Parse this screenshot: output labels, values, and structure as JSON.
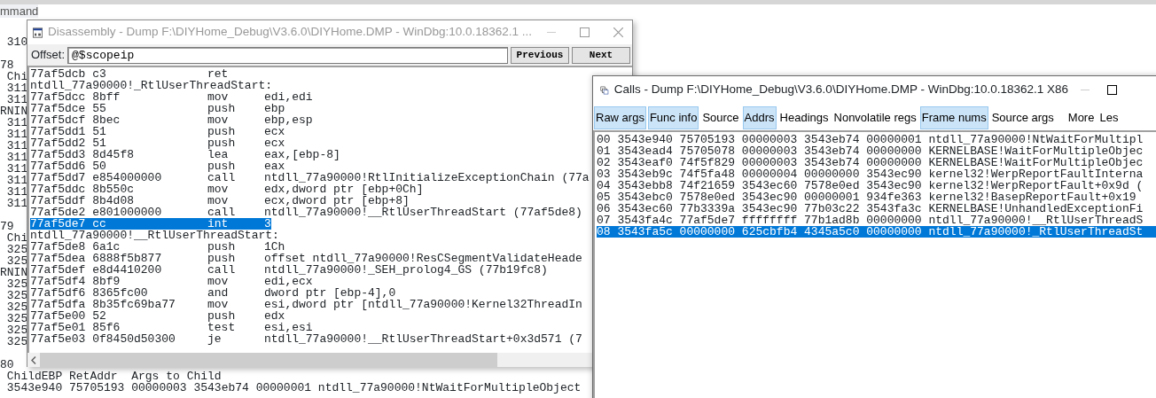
{
  "command_window": {
    "title": "mmand",
    "lines": [
      {
        "kind": "detail",
        "text": "310"
      },
      {
        "kind": "blank"
      },
      {
        "kind": "head",
        "text": "78"
      },
      {
        "kind": "detail",
        "text": "Chi"
      },
      {
        "kind": "detail",
        "text": "311"
      },
      {
        "kind": "detail",
        "text": "311"
      },
      {
        "kind": "head",
        "text": "RNIN"
      },
      {
        "kind": "detail",
        "text": "311"
      },
      {
        "kind": "detail",
        "text": "311"
      },
      {
        "kind": "detail",
        "text": "311"
      },
      {
        "kind": "detail",
        "text": "311"
      },
      {
        "kind": "detail",
        "text": "311"
      },
      {
        "kind": "detail",
        "text": "311"
      },
      {
        "kind": "detail",
        "text": "311"
      },
      {
        "kind": "detail",
        "text": "311"
      },
      {
        "kind": "blank"
      },
      {
        "kind": "head",
        "text": "79"
      },
      {
        "kind": "detail",
        "text": "Chi"
      },
      {
        "kind": "detail",
        "text": "325"
      },
      {
        "kind": "detail",
        "text": "325"
      },
      {
        "kind": "head",
        "text": "RNIN"
      },
      {
        "kind": "detail",
        "text": "325"
      },
      {
        "kind": "detail",
        "text": "325"
      },
      {
        "kind": "detail",
        "text": "325"
      },
      {
        "kind": "detail",
        "text": "325"
      },
      {
        "kind": "detail",
        "text": "325"
      },
      {
        "kind": "detail",
        "text": "325"
      },
      {
        "kind": "blank"
      },
      {
        "kind": "head",
        "text": "80"
      },
      {
        "kind": "detail",
        "text": "ChildEBP RetAddr  Args to Child"
      },
      {
        "kind": "detail",
        "text": "3543e940 75705193 00000003 3543eb74 00000001 ntdll_77a90000!NtWaitForMultipleObject"
      }
    ]
  },
  "disassembly_window": {
    "title": "Disassembly - Dump F:\\DIYHome_Debug\\V3.6.0\\DIYHome.DMP - WinDbg:10.0.18362.1 ...",
    "offset_label": "Offset:",
    "offset_value": "@$scopeip",
    "buttons": [
      "Previous",
      "Next"
    ],
    "lines": [
      {
        "kind": "instruction",
        "address": "77af5dcb",
        "bytes": "c3",
        "mnemonic": "ret",
        "selected": false
      },
      {
        "kind": "label",
        "text": "ntdll_77a90000!_RtlUserThreadStart:",
        "selected": false
      },
      {
        "kind": "instruction",
        "address": "77af5dcc",
        "bytes": "8bff",
        "mnemonic": "mov",
        "operands": "edi,edi",
        "selected": false
      },
      {
        "kind": "instruction",
        "address": "77af5dce",
        "bytes": "55",
        "mnemonic": "push",
        "operands": "ebp",
        "selected": false
      },
      {
        "kind": "instruction",
        "address": "77af5dcf",
        "bytes": "8bec",
        "mnemonic": "mov",
        "operands": "ebp,esp",
        "selected": false
      },
      {
        "kind": "instruction",
        "address": "77af5dd1",
        "bytes": "51",
        "mnemonic": "push",
        "operands": "ecx",
        "selected": false
      },
      {
        "kind": "instruction",
        "address": "77af5dd2",
        "bytes": "51",
        "mnemonic": "push",
        "operands": "ecx",
        "selected": false
      },
      {
        "kind": "instruction",
        "address": "77af5dd3",
        "bytes": "8d45f8",
        "mnemonic": "lea",
        "operands": "eax,[ebp-8]",
        "selected": false
      },
      {
        "kind": "instruction",
        "address": "77af5dd6",
        "bytes": "50",
        "mnemonic": "push",
        "operands": "eax",
        "selected": false
      },
      {
        "kind": "instruction",
        "address": "77af5dd7",
        "bytes": "e854000000",
        "mnemonic": "call",
        "operands": "ntdll_77a90000!RtlInitializeExceptionChain (77a",
        "selected": false
      },
      {
        "kind": "instruction",
        "address": "77af5ddc",
        "bytes": "8b550c",
        "mnemonic": "mov",
        "operands": "edx,dword ptr [ebp+0Ch]",
        "selected": false
      },
      {
        "kind": "instruction",
        "address": "77af5ddf",
        "bytes": "8b4d08",
        "mnemonic": "mov",
        "operands": "ecx,dword ptr [ebp+8]",
        "selected": false
      },
      {
        "kind": "instruction",
        "address": "77af5de2",
        "bytes": "e801000000",
        "mnemonic": "call",
        "operands": "ntdll_77a90000!__RtlUserThreadStart (77af5de8)",
        "selected": false
      },
      {
        "kind": "instruction",
        "address": "77af5de7",
        "bytes": "cc",
        "mnemonic": "int",
        "operands": "3",
        "selected": true
      },
      {
        "kind": "label",
        "text": "ntdll_77a90000!__RtlUserThreadStart:",
        "selected": false
      },
      {
        "kind": "instruction",
        "address": "77af5de8",
        "bytes": "6a1c",
        "mnemonic": "push",
        "operands": "1Ch",
        "selected": false
      },
      {
        "kind": "instruction",
        "address": "77af5dea",
        "bytes": "6888f5b877",
        "mnemonic": "push",
        "operands": "offset ntdll_77a90000!ResCSegmentValidateHeade",
        "selected": false
      },
      {
        "kind": "instruction",
        "address": "77af5def",
        "bytes": "e8d4410200",
        "mnemonic": "call",
        "operands": "ntdll_77a90000!_SEH_prolog4_GS (77b19fc8)",
        "selected": false
      },
      {
        "kind": "instruction",
        "address": "77af5df4",
        "bytes": "8bf9",
        "mnemonic": "mov",
        "operands": "edi,ecx",
        "selected": false
      },
      {
        "kind": "instruction",
        "address": "77af5df6",
        "bytes": "8365fc00",
        "mnemonic": "and",
        "operands": "dword ptr [ebp-4],0",
        "selected": false
      },
      {
        "kind": "instruction",
        "address": "77af5dfa",
        "bytes": "8b35fc69ba77",
        "mnemonic": "mov",
        "operands": "esi,dword ptr [ntdll_77a90000!Kernel32ThreadIn",
        "selected": false
      },
      {
        "kind": "instruction",
        "address": "77af5e00",
        "bytes": "52",
        "mnemonic": "push",
        "operands": "edx",
        "selected": false
      },
      {
        "kind": "instruction",
        "address": "77af5e01",
        "bytes": "85f6",
        "mnemonic": "test",
        "operands": "esi,esi",
        "selected": false
      },
      {
        "kind": "instruction",
        "address": "77af5e03",
        "bytes": "0f8450d50300",
        "mnemonic": "je",
        "operands": "ntdll_77a90000!__RtlUserThreadStart+0x3d571 (7",
        "selected": false
      }
    ]
  },
  "calls_window": {
    "title": "Calls - Dump F:\\DIYHome_Debug\\V3.6.0\\DIYHome.DMP - WinDbg:10.0.18362.1 X86",
    "toolbar": [
      {
        "label": "Raw args",
        "selected": true
      },
      {
        "label": "Func info",
        "selected": true
      },
      {
        "label": "Source",
        "selected": false
      },
      {
        "label": "Addrs",
        "selected": true
      },
      {
        "label": "Headings",
        "selected": false
      },
      {
        "label": "Nonvolatile regs",
        "selected": false
      },
      {
        "label": "Frame nums",
        "selected": true
      },
      {
        "label": "Source args",
        "selected": false
      },
      {
        "label": "More",
        "selected": false
      },
      {
        "label": "Les",
        "selected": false
      }
    ],
    "frames": [
      {
        "num": "00",
        "child_ebp": "3543e940",
        "ret_addr": "75705193",
        "args": [
          "00000003",
          "3543eb74",
          "00000001"
        ],
        "call_site": "ntdll_77a90000!NtWaitForMultipl",
        "selected": false
      },
      {
        "num": "01",
        "child_ebp": "3543ead4",
        "ret_addr": "75705078",
        "args": [
          "00000003",
          "3543eb74",
          "00000000"
        ],
        "call_site": "KERNELBASE!WaitForMultipleObjec",
        "selected": false
      },
      {
        "num": "02",
        "child_ebp": "3543eaf0",
        "ret_addr": "74f5f829",
        "args": [
          "00000003",
          "3543eb74",
          "00000000"
        ],
        "call_site": "KERNELBASE!WaitForMultipleObjec",
        "selected": false
      },
      {
        "num": "03",
        "child_ebp": "3543eb9c",
        "ret_addr": "74f5fa48",
        "args": [
          "00000004",
          "00000000",
          "3543ec90"
        ],
        "call_site": "kernel32!WerpReportFaultInterna",
        "selected": false
      },
      {
        "num": "04",
        "child_ebp": "3543ebb8",
        "ret_addr": "74f21659",
        "args": [
          "3543ec60",
          "7578e0ed",
          "3543ec90"
        ],
        "call_site": "kernel32!WerpReportFault+0x9d (",
        "selected": false
      },
      {
        "num": "05",
        "child_ebp": "3543ebc0",
        "ret_addr": "7578e0ed",
        "args": [
          "3543ec90",
          "00000001",
          "934fe363"
        ],
        "call_site": "kernel32!BasepReportFault+0x19",
        "selected": false
      },
      {
        "num": "06",
        "child_ebp": "3543ec60",
        "ret_addr": "77b3339a",
        "args": [
          "3543ec90",
          "77b03c22",
          "3543fa3c"
        ],
        "call_site": "KERNELBASE!UnhandledExceptionFi",
        "selected": false
      },
      {
        "num": "07",
        "child_ebp": "3543fa4c",
        "ret_addr": "77af5de7",
        "args": [
          "ffffffff",
          "77b1ad8b",
          "00000000"
        ],
        "call_site": "ntdll_77a90000!__RtlUserThreadS",
        "selected": false
      },
      {
        "num": "08",
        "child_ebp": "3543fa5c",
        "ret_addr": "00000000",
        "args": [
          "625cbfb4",
          "4345a5c0",
          "00000000"
        ],
        "call_site": "ntdll_77a90000!_RtlUserThreadSt",
        "selected": true
      }
    ]
  }
}
